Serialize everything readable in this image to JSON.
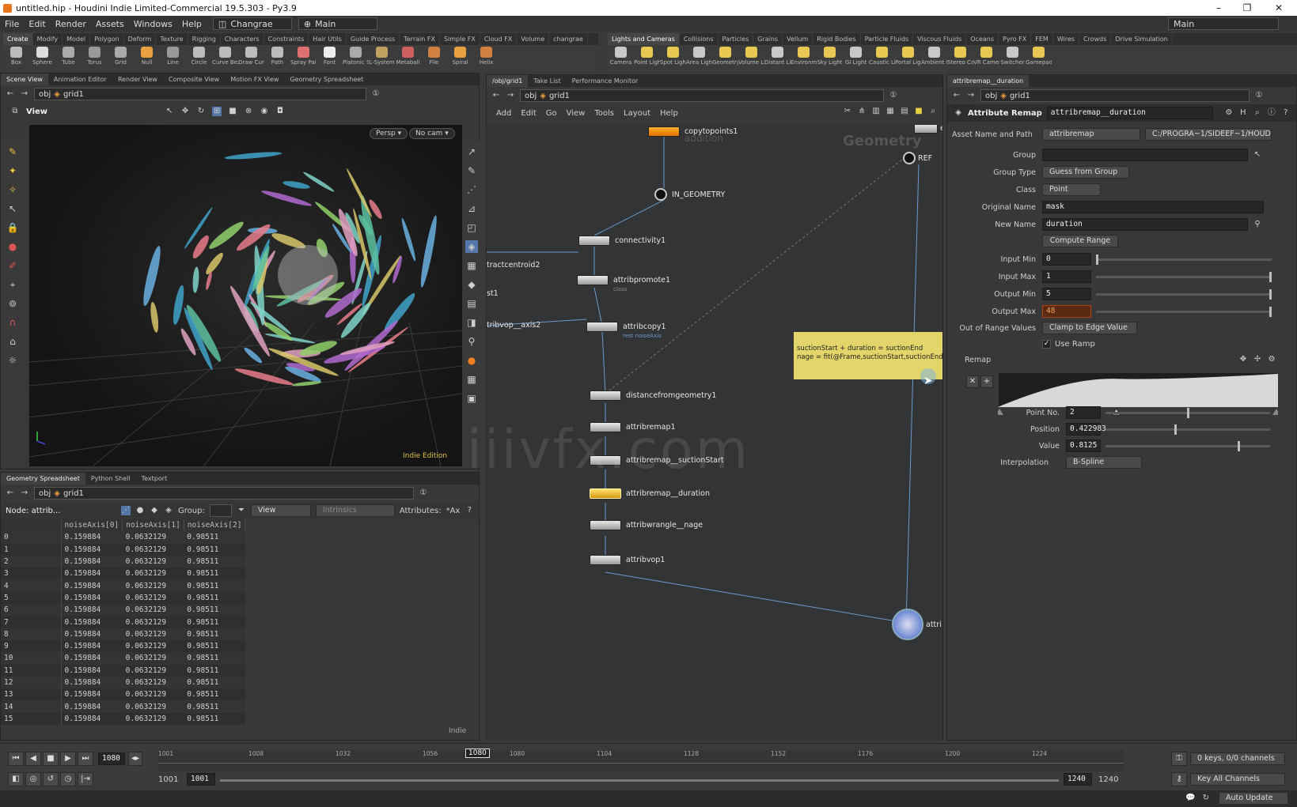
{
  "window": {
    "title": "untitled.hip - Houdini Indie Limited-Commercial 19.5.303 - Py3.9",
    "min": "–",
    "max": "❐",
    "close": "✕"
  },
  "menu": {
    "items": [
      "File",
      "Edit",
      "Render",
      "Assets",
      "Windows",
      "Help"
    ],
    "desktop_left": "Changrae",
    "desktop_main": "Main",
    "desktop_right": "Main"
  },
  "shelf_left": {
    "tabs": [
      "Create",
      "Modify",
      "Model",
      "Polygon",
      "Deform",
      "Texture",
      "Rigging",
      "Characters",
      "Constraints",
      "Hair Utils",
      "Guide Process",
      "Terrain FX",
      "Simple FX",
      "Cloud FX",
      "Volume",
      "changrae"
    ],
    "tools": [
      "Box",
      "Sphere",
      "Tube",
      "Torus",
      "Grid",
      "Null",
      "Line",
      "Circle",
      "Curve Bezier",
      "Draw Curve",
      "Path",
      "Spray Paint",
      "Font",
      "Platonic Solids",
      "L-System",
      "Metaball",
      "File",
      "Spiral",
      "Helix"
    ]
  },
  "shelf_right": {
    "tabs": [
      "Lights and Cameras",
      "Collisions",
      "Particles",
      "Grains",
      "Vellum",
      "Rigid Bodies",
      "Particle Fluids",
      "Viscous Fluids",
      "Oceans",
      "Pyro FX",
      "FEM",
      "Wires",
      "Crowds",
      "Drive Simulation"
    ],
    "tools": [
      "Camera",
      "Point Light",
      "Spot Light",
      "Area Light",
      "Geometry Light",
      "Volume Light",
      "Distant Light",
      "Environment Light",
      "Sky Light",
      "GI Light",
      "Caustic Light",
      "Portal Light",
      "Ambient Light",
      "Stereo Camera",
      "VR Camera",
      "Switcher",
      "Gamepad Camera"
    ]
  },
  "scene_panel": {
    "tabs": [
      "Scene View",
      "Animation Editor",
      "Render View",
      "Composite View",
      "Motion FX View",
      "Geometry Spreadsheet"
    ],
    "path_obj": "obj",
    "path_node": "grid1",
    "view_label": "View",
    "persp": "Persp ▾",
    "nocam": "No cam ▾",
    "edition": "Indie Edition"
  },
  "spreadsheet": {
    "tabs": [
      "Geometry Spreadsheet",
      "Python Shell",
      "Textport"
    ],
    "path_obj": "obj",
    "path_node": "grid1",
    "node_label": "Node: attrib...",
    "group_label": "Group:",
    "view_menu": "View",
    "intrinsics": "Intrinsics",
    "attributes_label": "Attributes:",
    "attributes_value": "*Ax",
    "columns": [
      "",
      "noiseAxis[0]",
      "noiseAxis[1]",
      "noiseAxis[2]"
    ],
    "rows": [
      [
        "0",
        "0.159884",
        "0.0632129",
        "0.98511"
      ],
      [
        "1",
        "0.159884",
        "0.0632129",
        "0.98511"
      ],
      [
        "2",
        "0.159884",
        "0.0632129",
        "0.98511"
      ],
      [
        "3",
        "0.159884",
        "0.0632129",
        "0.98511"
      ],
      [
        "4",
        "0.159884",
        "0.0632129",
        "0.98511"
      ],
      [
        "5",
        "0.159884",
        "0.0632129",
        "0.98511"
      ],
      [
        "6",
        "0.159884",
        "0.0632129",
        "0.98511"
      ],
      [
        "7",
        "0.159884",
        "0.0632129",
        "0.98511"
      ],
      [
        "8",
        "0.159884",
        "0.0632129",
        "0.98511"
      ],
      [
        "9",
        "0.159884",
        "0.0632129",
        "0.98511"
      ],
      [
        "10",
        "0.159884",
        "0.0632129",
        "0.98511"
      ],
      [
        "11",
        "0.159884",
        "0.0632129",
        "0.98511"
      ],
      [
        "12",
        "0.159884",
        "0.0632129",
        "0.98511"
      ],
      [
        "13",
        "0.159884",
        "0.0632129",
        "0.98511"
      ],
      [
        "14",
        "0.159884",
        "0.0632129",
        "0.98511"
      ],
      [
        "15",
        "0.159884",
        "0.0632129",
        "0.98511"
      ]
    ],
    "footer": "Indie"
  },
  "network": {
    "tabs": [
      "/obj/grid1",
      "Take List",
      "Performance Monitor"
    ],
    "path_obj": "obj",
    "path_node": "grid1",
    "menu": [
      "Add",
      "Edit",
      "Go",
      "View",
      "Tools",
      "Layout",
      "Help"
    ],
    "context_label": "Geometry",
    "nodes": {
      "copytopoints": "copytopoints1",
      "copytopoints_sub": "addition",
      "in_geometry": "IN_GEOMETRY",
      "connectivity": "connectivity1",
      "extractcentroid": "tractcentroid2",
      "attribpromote": "attribpromote1",
      "attribpromote_sub": "class",
      "st1": "st1",
      "attribvop_axis": "tribvop__axis2",
      "attribcopy": "attribcopy1",
      "attribcopy_sub": "rest noiseAxis",
      "distance": "distancefromgeometry1",
      "remap1": "attribremap1",
      "remap_suction": "attribremap__suctionStart",
      "remap_duration": "attribremap__duration",
      "wrangle": "attribwrangle__nage",
      "vop1": "attribvop1",
      "ref": "REF",
      "ex": "ex",
      "attri": "attri"
    },
    "sticky": {
      "line1": "suctionStart + duration = suctionEnd",
      "line2": "nage = fit(@Frame,suctionStart,suctionEnd,0,1"
    }
  },
  "params": {
    "tab": "attribremap__duration",
    "path_obj": "obj",
    "path_node": "grid1",
    "node_type": "Attribute Remap",
    "node_name": "attribremap__duration",
    "asset_label": "Asset Name and Path",
    "asset_name": "attribremap",
    "asset_path": "C:/PROGRA~1/SIDEEF~1/HOUD...",
    "group_label": "Group",
    "group_value": "",
    "grouptype_label": "Group Type",
    "grouptype_value": "Guess from Group",
    "class_label": "Class",
    "class_value": "Point",
    "origname_label": "Original Name",
    "origname_value": "mask",
    "newname_label": "New Name",
    "newname_value": "duration",
    "compute_range": "Compute Range",
    "inmin_label": "Input Min",
    "inmin_value": "0",
    "inmin_frac": 0.0,
    "inmax_label": "Input Max",
    "inmax_value": "1",
    "inmax_frac": 1.0,
    "outmin_label": "Output Min",
    "outmin_value": "5",
    "outmin_frac": 1.0,
    "outmax_label": "Output Max",
    "outmax_value": "48",
    "outmax_frac": 1.0,
    "oor_label": "Out of Range Values",
    "oor_value": "Clamp to Edge Value",
    "use_ramp": "Use Ramp",
    "remap_label": "Remap",
    "pointno_label": "Point No.",
    "pointno_value": "2",
    "pointno_frac": 0.5,
    "position_label": "Position",
    "position_value": "0.422983",
    "position_frac": 0.422983,
    "value_label": "Value",
    "value_value": "0.8125",
    "value_frac": 0.8125,
    "interp_label": "Interpolation",
    "interp_value": "B-Spline"
  },
  "timeline": {
    "current_frame": "1080",
    "marker": "1080",
    "ticks": [
      "1001",
      "1008",
      "1032",
      "1056",
      "1080",
      "1104",
      "1128",
      "1152",
      "1176",
      "1200",
      "1224"
    ],
    "range_start": "1001",
    "range_start2": "1001",
    "range_end": "1240",
    "range_end2": "1240",
    "keys": "0 keys, 0/0 channels",
    "key_all": "Key All Channels",
    "auto_update": "Auto Update"
  },
  "watermark": "iiivfx.com"
}
